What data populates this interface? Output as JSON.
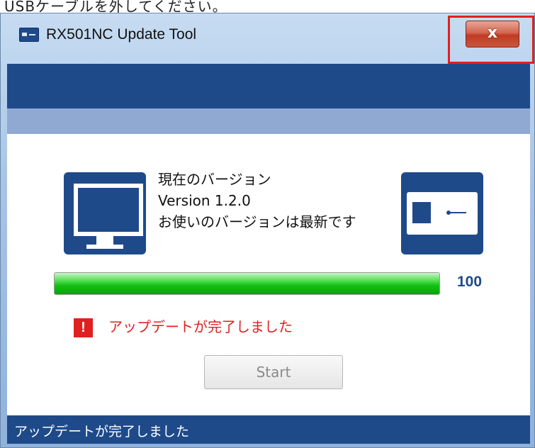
{
  "caption": "USBケーブルを外してください。",
  "window": {
    "title": "RX501NC Update Tool",
    "close_glyph": "x"
  },
  "icons": {
    "app": "app-window-icon",
    "pc": "monitor-icon",
    "device": "device-icon",
    "warning": "warning-icon",
    "warning_glyph": "!"
  },
  "info": {
    "line1": "現在のバージョン",
    "line2": "Version 1.2.0",
    "line3": "お使いのバージョンは最新です"
  },
  "progress": {
    "value": 100,
    "label": "100"
  },
  "message": "アップデートが完了しました",
  "start_label": "Start",
  "statusbar_text": "アップデートが完了しました",
  "colors": {
    "brand_blue": "#1e4a8a",
    "band_light": "#8fa9d3",
    "progress_green": "#13c013",
    "alert_red": "#e02020",
    "close_red": "#c9553c"
  }
}
